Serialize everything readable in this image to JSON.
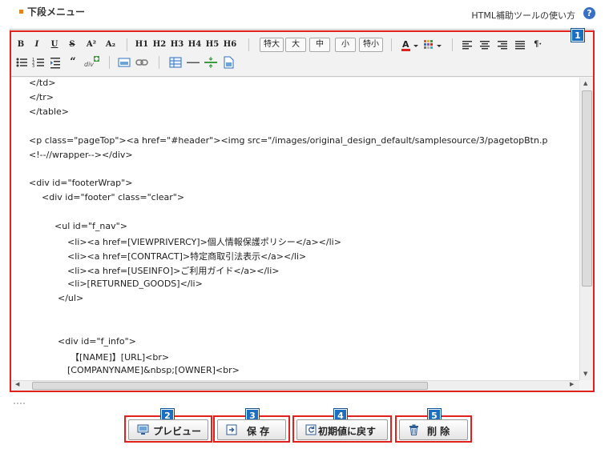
{
  "section_title": "下段メニュー",
  "help": {
    "label": "HTML補助ツールの使い方",
    "icon_char": "?"
  },
  "toolbar": {
    "format": [
      "B",
      "I",
      "U",
      "S",
      "A²",
      "A₂"
    ],
    "headings": [
      "H1",
      "H2",
      "H3",
      "H4",
      "H5",
      "H6"
    ],
    "font_sizes": [
      "特大",
      "大",
      "中",
      "小",
      "特小"
    ],
    "pilcrow": "¶·"
  },
  "badges": [
    "1",
    "2",
    "3",
    "4",
    "5"
  ],
  "code_lines": [
    "</td>",
    "</tr>",
    "</table>",
    "",
    "<p class=\"pageTop\"><a href=\"#header\"><img src=\"/images/original_design_default/samplesource/3/pagetopBtn.p",
    "<!--//wrapper--></div>",
    "",
    "<div id=\"footerWrap\">",
    "    <div id=\"footer\" class=\"clear\">",
    "",
    "        <ul id=\"f_nav\">",
    "            <li><a href=[VIEWPRIVERCY]>個人情報保護ポリシー</a></li>",
    "            <li><a href=[CONTRACT]>特定商取引法表示</a></li>",
    "            <li><a href=[USEINFO]>ご利用ガイド</a></li>",
    "            <li>[RETURNED_GOODS]</li>",
    "         </ul>",
    "",
    "",
    "         <div id=\"f_info\">",
    "             【[NAME]】[URL]<br>",
    "            [COMPANYNAME]&nbsp;[OWNER]<br>"
  ],
  "buttons": {
    "preview": "プレビュー",
    "save": "保 存",
    "reset": "初期値に戻す",
    "delete": "削 除"
  },
  "colors": {
    "highlight": "#e3211c",
    "badge": "#1c6fc0",
    "bullet": "#e0841c"
  }
}
